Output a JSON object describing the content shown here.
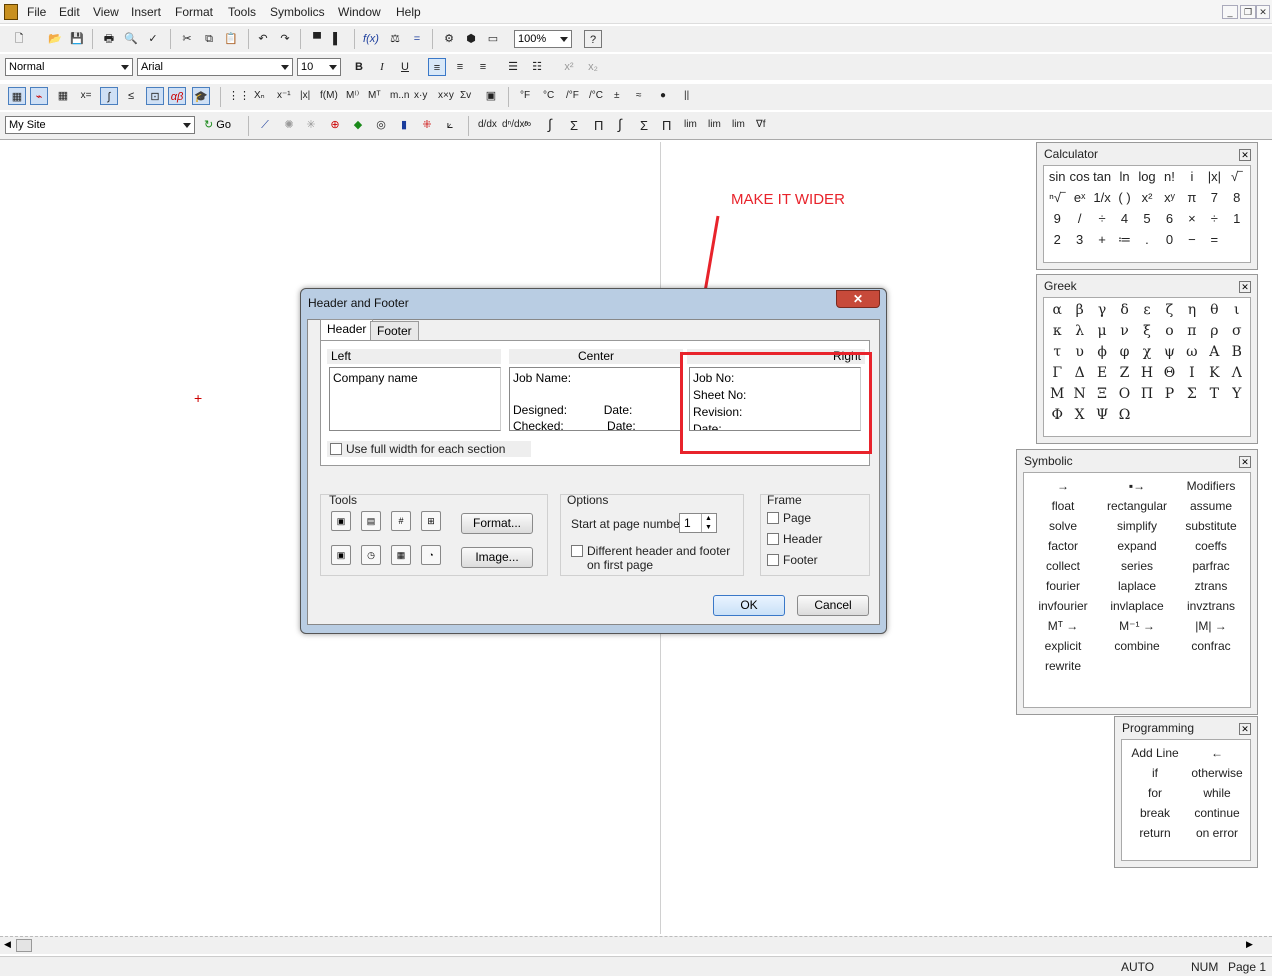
{
  "menubar": {
    "items": [
      "File",
      "Edit",
      "View",
      "Insert",
      "Format",
      "Tools",
      "Symbolics",
      "Window",
      "Help"
    ]
  },
  "toolbar": {
    "zoom": "100%",
    "style": "Normal",
    "font": "Arial",
    "size": "10",
    "site": "My Site",
    "go_label": "Go",
    "unit_labels": [
      "°F",
      "°C",
      "/°F",
      "/°C",
      "±",
      "≈",
      "●",
      "||"
    ]
  },
  "annotation": {
    "text": "MAKE IT WIDER",
    "color": "#e8232b"
  },
  "dialog": {
    "title": "Header and Footer",
    "tabs": [
      "Header",
      "Footer"
    ],
    "sections": {
      "left": {
        "label": "Left",
        "lines": [
          "Company name"
        ]
      },
      "center": {
        "label": "Center",
        "lines": [
          "Job Name:",
          "",
          "Designed:           Date:",
          "Checked:             Date:"
        ]
      },
      "right": {
        "label": "Right",
        "lines": [
          "Job No:",
          "Sheet No:",
          "Revision:",
          "Date:"
        ]
      }
    },
    "use_full_width": "Use full width for each section",
    "tools_label": "Tools",
    "format_btn": "Format...",
    "image_btn": "Image...",
    "options_label": "Options",
    "start_page_label": "Start at page number",
    "start_page_value": "1",
    "different_first_line1": "Different header and footer",
    "different_first_line2": "on first page",
    "frame_label": "Frame",
    "frame_page": "Page",
    "frame_header": "Header",
    "frame_footer": "Footer",
    "ok": "OK",
    "cancel": "Cancel"
  },
  "palettes": {
    "calculator": {
      "title": "Calculator",
      "rows": [
        [
          "sin",
          "cos",
          "tan",
          "ln",
          "log",
          "n!",
          "i",
          "|x|",
          "√‾"
        ],
        [
          "ⁿ√‾",
          "eˣ",
          "1/x",
          "( )",
          "x²",
          "xʸ",
          "π",
          "7",
          "8"
        ],
        [
          "9",
          "/",
          "÷",
          "4",
          "5",
          "6",
          "×",
          "÷",
          "1"
        ],
        [
          "2",
          "3",
          "+",
          "≔",
          ".",
          "0",
          "−",
          "="
        ]
      ]
    },
    "greek": {
      "title": "Greek",
      "rows": [
        [
          "α",
          "β",
          "γ",
          "δ",
          "ε",
          "ζ",
          "η",
          "θ",
          "ι"
        ],
        [
          "κ",
          "λ",
          "μ",
          "ν",
          "ξ",
          "ο",
          "π",
          "ρ",
          "σ"
        ],
        [
          "τ",
          "υ",
          "ϕ",
          "φ",
          "χ",
          "ψ",
          "ω",
          "Α",
          "Β"
        ],
        [
          "Γ",
          "Δ",
          "Ε",
          "Ζ",
          "Η",
          "Θ",
          "Ι",
          "Κ",
          "Λ"
        ],
        [
          "Μ",
          "Ν",
          "Ξ",
          "Ο",
          "Π",
          "Ρ",
          "Σ",
          "Τ",
          "Υ"
        ],
        [
          "Φ",
          "Χ",
          "Ψ",
          "Ω"
        ]
      ]
    },
    "symbolic": {
      "title": "Symbolic",
      "rows": [
        [
          "→",
          "▪→",
          "Modifiers"
        ],
        [
          "float",
          "rectangular",
          "assume"
        ],
        [
          "solve",
          "simplify",
          "substitute"
        ],
        [
          "factor",
          "expand",
          "coeffs"
        ],
        [
          "collect",
          "series",
          "parfrac"
        ],
        [
          "fourier",
          "laplace",
          "ztrans"
        ],
        [
          "invfourier",
          "invlaplace",
          "invztrans"
        ],
        [
          "Mᵀ →",
          "M⁻¹ →",
          "|M| →"
        ],
        [
          "explicit",
          "combine",
          "confrac"
        ],
        [
          "rewrite"
        ]
      ]
    },
    "programming": {
      "title": "Programming",
      "rows": [
        [
          "Add Line",
          "←"
        ],
        [
          "if",
          "otherwise"
        ],
        [
          "for",
          "while"
        ],
        [
          "break",
          "continue"
        ],
        [
          "return",
          "on error"
        ]
      ]
    }
  },
  "status": {
    "auto": "AUTO",
    "num": "NUM",
    "page": "Page 1"
  }
}
